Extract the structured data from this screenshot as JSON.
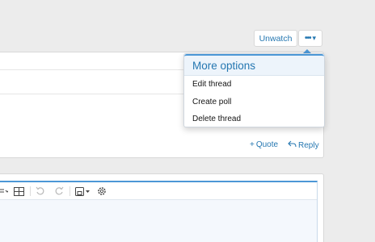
{
  "thread_actions": {
    "unwatch_label": "Unwatch"
  },
  "more_menu": {
    "title": "More options",
    "items": [
      {
        "label": "Edit thread"
      },
      {
        "label": "Create poll"
      },
      {
        "label": "Delete thread"
      }
    ]
  },
  "post_actions": {
    "quote_label": "Quote",
    "reply_label": "Reply"
  },
  "editor_toolbar": {
    "icons": [
      "list-icon",
      "table-icon",
      "undo-icon",
      "redo-icon",
      "save-drafts-icon",
      "settings-icon"
    ]
  },
  "colors": {
    "accent": "#2577b1",
    "accent_border": "#4c97d6",
    "page_bg": "#ececec"
  }
}
